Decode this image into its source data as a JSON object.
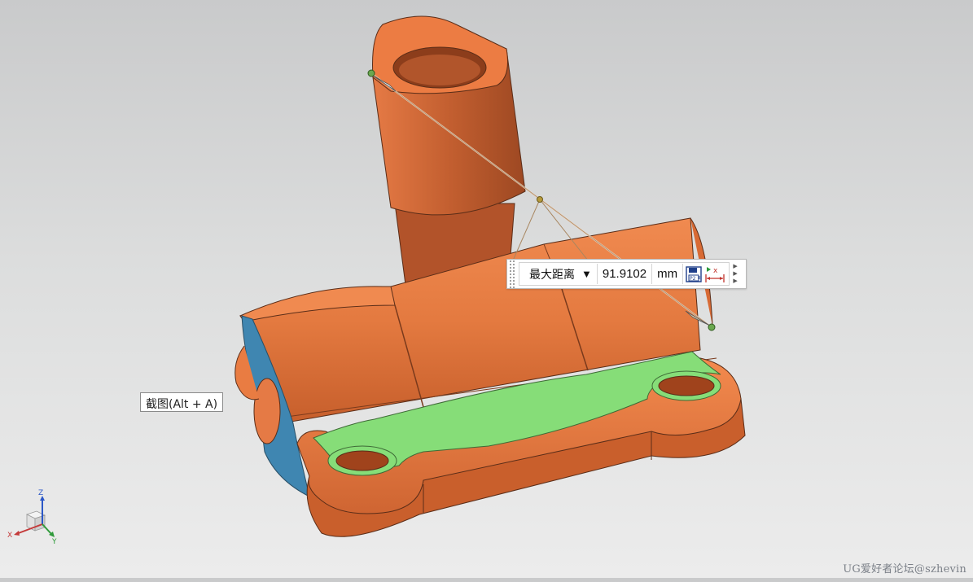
{
  "measure_toolbar": {
    "type_label": "最大距离",
    "dropdown_symbol": "▼",
    "value": "91.9102",
    "unit": "mm",
    "icons": [
      "save-to-part-icon",
      "dimension-icon"
    ]
  },
  "tooltip": {
    "text": "截图(Alt + A)"
  },
  "watermark": {
    "text": "UG爱好者论坛@szhevin"
  },
  "triad": {
    "x_label": "X",
    "y_label": "Y",
    "z_label": "Z"
  },
  "colors": {
    "body": "#e8763e",
    "body_shadow": "#b9542a",
    "cut_face": "#86dd78",
    "side_face": "#3f86b1",
    "measure_line": "#c9a882",
    "point": "#6aa84f"
  }
}
